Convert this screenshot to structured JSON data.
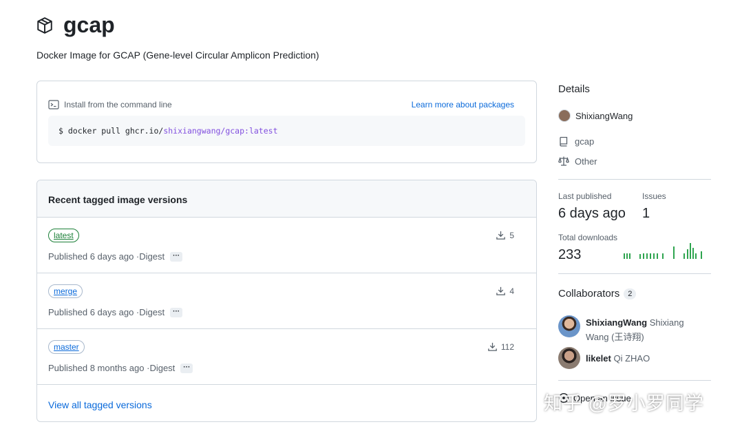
{
  "package": {
    "name": "gcap",
    "description": "Docker Image for GCAP (Gene-level Circular Amplicon Prediction)"
  },
  "install": {
    "header": "Install from the command line",
    "learn_more": "Learn more about packages",
    "cmd_prefix": "$ docker pull ghcr.io/",
    "cmd_highlight": "shixiangwang/gcap:latest"
  },
  "versions": {
    "header": "Recent tagged image versions",
    "digest_label": "Digest",
    "dots": "···",
    "rows": [
      {
        "tag": "latest",
        "published": "Published 6 days ago · ",
        "downloads": "5"
      },
      {
        "tag": "merge",
        "published": "Published 6 days ago · ",
        "downloads": "4"
      },
      {
        "tag": "master",
        "published": "Published 8 months ago · ",
        "downloads": "112"
      }
    ],
    "view_all": "View all tagged versions"
  },
  "details": {
    "title": "Details",
    "owner": "ShixiangWang",
    "repo": "gcap",
    "license": "Other",
    "last_published_label": "Last published",
    "last_published_value": "6 days ago",
    "issues_label": "Issues",
    "issues_value": "1",
    "downloads_label": "Total downloads",
    "downloads_value": "233"
  },
  "collaborators": {
    "title": "Collaborators",
    "count": "2",
    "list": [
      {
        "login": "ShixiangWang",
        "name": "Shixiang Wang (王诗翔)"
      },
      {
        "login": "likelet",
        "name": "Qi ZHAO"
      }
    ]
  },
  "open_issue": "Open an issue",
  "watermark": "知乎 @罗小罗同学",
  "colors": {
    "link": "#0969da",
    "green": "#1a7f37",
    "highlight": "#8250df"
  }
}
